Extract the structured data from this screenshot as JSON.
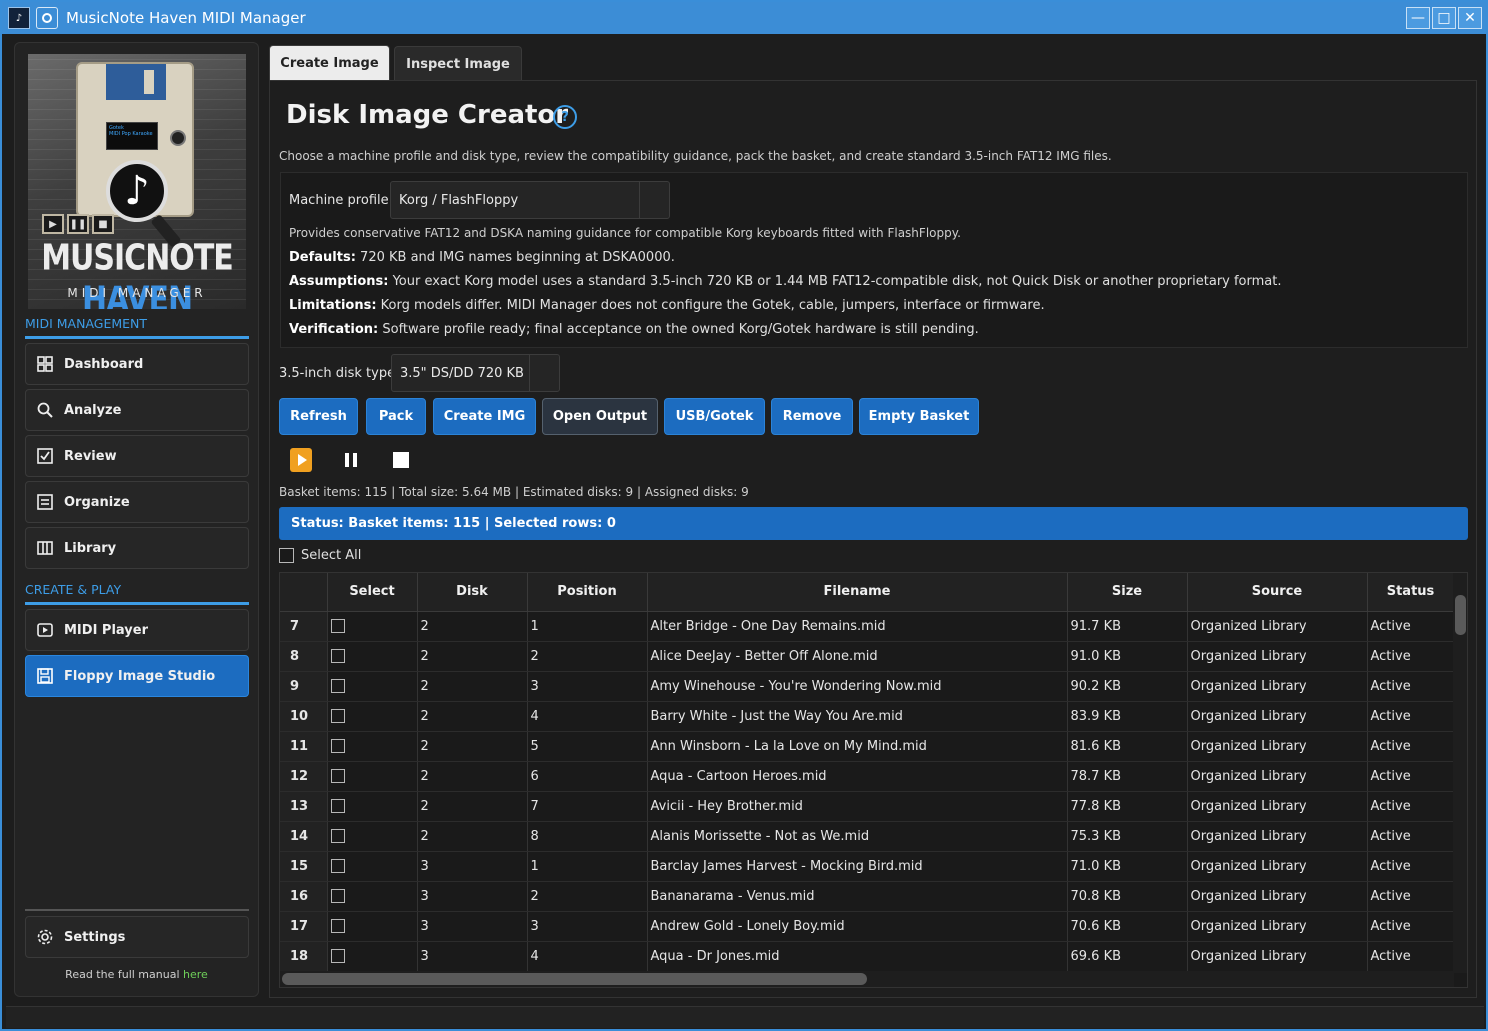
{
  "window": {
    "title": "MusicNote Haven MIDI Manager",
    "minimize": "—",
    "maximize": "□",
    "close": "✕",
    "accent": "#3c8dd6"
  },
  "sidebar": {
    "logo": {
      "brand_white": "MUSICNOTE",
      "brand_blue": "HAVEN",
      "subtitle": "MIDI MANAGER",
      "screen_line1": "Gotek",
      "screen_line2": "MIDI Pop Karaoke"
    },
    "section_midi": "MIDI MANAGEMENT",
    "section_create": "CREATE & PLAY",
    "items": [
      {
        "label": "Dashboard",
        "icon": "grid-icon"
      },
      {
        "label": "Analyze",
        "icon": "search-icon"
      },
      {
        "label": "Review",
        "icon": "checkbox-icon"
      },
      {
        "label": "Organize",
        "icon": "list-icon"
      },
      {
        "label": "Library",
        "icon": "columns-icon"
      },
      {
        "label": "MIDI Player",
        "icon": "play-box-icon"
      },
      {
        "label": "Floppy Image Studio",
        "icon": "floppy-icon"
      }
    ],
    "settings": "Settings",
    "manual_text": "Read the full manual",
    "manual_link": "here"
  },
  "tabs": [
    {
      "label": "Create Image",
      "active": true
    },
    {
      "label": "Inspect Image",
      "active": false
    }
  ],
  "main": {
    "title": "Disk Image Creator",
    "help": "?",
    "intro": "Choose a machine profile and disk type, review the compatibility guidance, pack the basket, and create standard 3.5-inch FAT12 IMG files.",
    "machine_profile_label": "Machine profile",
    "machine_profile_value": "Korg / FlashFloppy",
    "profile_desc": "Provides conservative FAT12 and DSKA naming guidance for compatible Korg keyboards fitted with FlashFloppy.",
    "defaults_label": "Defaults:",
    "defaults_text": "720 KB and IMG names beginning at DSKA0000.",
    "assumptions_label": "Assumptions:",
    "assumptions_text": "Your exact Korg model uses a standard 3.5-inch 720 KB or 1.44 MB FAT12-compatible disk, not Quick Disk or another proprietary format.",
    "limitations_label": "Limitations:",
    "limitations_text": "Korg models differ. MIDI Manager does not configure the Gotek, cable, jumpers, interface or firmware.",
    "verification_label": "Verification:",
    "verification_text": "Software profile ready; final acceptance on the owned Korg/Gotek hardware is still pending.",
    "disk_type_label": "3.5-inch disk type",
    "disk_type_value": "3.5\" DS/DD 720 KB",
    "buttons": {
      "refresh": "Refresh",
      "pack": "Pack",
      "create_img": "Create IMG",
      "open_output": "Open Output",
      "usb_gotek": "USB/Gotek",
      "remove": "Remove",
      "empty_basket": "Empty Basket"
    },
    "stats": "Basket items: 115 | Total size: 5.64 MB | Estimated disks: 9 | Assigned disks: 9",
    "status": "Status: Basket items: 115 | Selected rows: 0",
    "select_all": "Select All"
  },
  "table": {
    "columns": [
      "",
      "Select",
      "Disk",
      "Position",
      "Filename",
      "Size",
      "Source",
      "Status"
    ],
    "rows": [
      {
        "n": "7",
        "disk": "2",
        "pos": "1",
        "file": "Alter Bridge - One Day Remains.mid",
        "size": "91.7 KB",
        "source": "Organized Library",
        "status": "Active"
      },
      {
        "n": "8",
        "disk": "2",
        "pos": "2",
        "file": "Alice DeeJay - Better Off Alone.mid",
        "size": "91.0 KB",
        "source": "Organized Library",
        "status": "Active"
      },
      {
        "n": "9",
        "disk": "2",
        "pos": "3",
        "file": "Amy Winehouse - You're Wondering Now.mid",
        "size": "90.2 KB",
        "source": "Organized Library",
        "status": "Active"
      },
      {
        "n": "10",
        "disk": "2",
        "pos": "4",
        "file": "Barry White - Just the Way You Are.mid",
        "size": "83.9 KB",
        "source": "Organized Library",
        "status": "Active"
      },
      {
        "n": "11",
        "disk": "2",
        "pos": "5",
        "file": "Ann Winsborn - La la Love on My Mind.mid",
        "size": "81.6 KB",
        "source": "Organized Library",
        "status": "Active"
      },
      {
        "n": "12",
        "disk": "2",
        "pos": "6",
        "file": "Aqua - Cartoon Heroes.mid",
        "size": "78.7 KB",
        "source": "Organized Library",
        "status": "Active"
      },
      {
        "n": "13",
        "disk": "2",
        "pos": "7",
        "file": "Avicii - Hey Brother.mid",
        "size": "77.8 KB",
        "source": "Organized Library",
        "status": "Active"
      },
      {
        "n": "14",
        "disk": "2",
        "pos": "8",
        "file": "Alanis Morissette - Not as We.mid",
        "size": "75.3 KB",
        "source": "Organized Library",
        "status": "Active"
      },
      {
        "n": "15",
        "disk": "3",
        "pos": "1",
        "file": "Barclay James Harvest - Mocking Bird.mid",
        "size": "71.0 KB",
        "source": "Organized Library",
        "status": "Active"
      },
      {
        "n": "16",
        "disk": "3",
        "pos": "2",
        "file": "Bananarama - Venus.mid",
        "size": "70.8 KB",
        "source": "Organized Library",
        "status": "Active"
      },
      {
        "n": "17",
        "disk": "3",
        "pos": "3",
        "file": "Andrew Gold - Lonely Boy.mid",
        "size": "70.6 KB",
        "source": "Organized Library",
        "status": "Active"
      },
      {
        "n": "18",
        "disk": "3",
        "pos": "4",
        "file": "Aqua - Dr Jones.mid",
        "size": "69.6 KB",
        "source": "Organized Library",
        "status": "Active"
      }
    ]
  }
}
